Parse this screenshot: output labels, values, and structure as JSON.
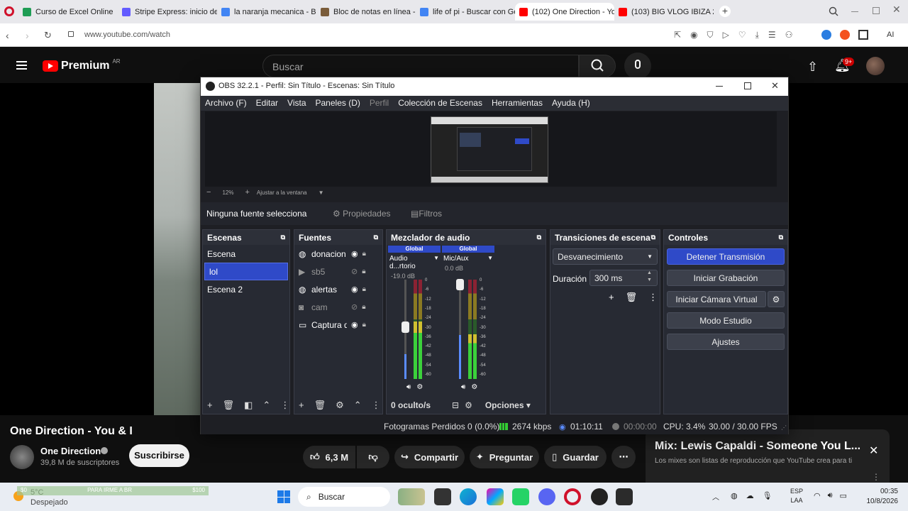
{
  "browser": {
    "tabs": [
      {
        "label": "Curso de Excel Online",
        "color": "#1f9d55"
      },
      {
        "label": "Stripe Express: inicio de se",
        "color": "#635bff"
      },
      {
        "label": "la naranja mecanica - Busc",
        "color": "#4285f4"
      },
      {
        "label": "Bloc de notas en línea - To",
        "color": "#7a5c3a"
      },
      {
        "label": "life of pi - Buscar con Goo",
        "color": "#4285f4"
      },
      {
        "label": "(102) One Direction - You",
        "color": "#ff0000"
      },
      {
        "label": "(103) BIG VLOG IBIZA 202",
        "color": "#ff0000"
      }
    ],
    "url": "www.youtube.com/watch",
    "new_tab": "+",
    "ai_label": "AI"
  },
  "youtube": {
    "logo_text": "Premium",
    "logo_region": "AR",
    "search_placeholder": "Buscar",
    "notif_count": "9+",
    "video_title": "One Direction - You & I",
    "channel_name": "One Direction",
    "subscribers": "39,8 M de suscriptores",
    "subscribe_label": "Suscribirse",
    "likes": "6,3 M",
    "share_label": "Compartir",
    "ask_label": "Preguntar",
    "save_label": "Guardar",
    "mix_title": "Mix: Lewis Capaldi - Someone You L...",
    "mix_subtitle": "Los mixes son listas de reproducción que YouTube crea para ti"
  },
  "obs": {
    "title": "OBS 32.2.1 - Perfil: Sin Título - Escenas: Sin Título",
    "menu": [
      "Archivo (F)",
      "Editar",
      "Vista",
      "Paneles (D)",
      "Perfil",
      "Colección de Escenas",
      "Herramientas",
      "Ayuda (H)"
    ],
    "zoom": "12%",
    "fit_label": "Ajustar a la ventana",
    "no_source": "Ninguna fuente selecciona",
    "properties": "Propiedades",
    "filters": "Filtros",
    "scenes": {
      "header": "Escenas",
      "items": [
        "Escena",
        "lol",
        "Escena 2"
      ],
      "selected": 1
    },
    "sources": {
      "header": "Fuentes",
      "items": [
        {
          "name": "donacion",
          "visible": true,
          "icon": "browser-icon"
        },
        {
          "name": "sb5",
          "visible": false,
          "icon": "media-icon"
        },
        {
          "name": "alertas",
          "visible": true,
          "icon": "browser-icon"
        },
        {
          "name": "cam",
          "visible": false,
          "icon": "camera-icon"
        },
        {
          "name": "Captura d",
          "visible": true,
          "icon": "display-icon"
        }
      ]
    },
    "mixer": {
      "header": "Mezclador de audio",
      "hidden": "0 oculto/s",
      "options": "Opciones",
      "channels": [
        {
          "scope": "Global",
          "name": "Audio d...rtorio",
          "db": "-19.0 dB",
          "level": 0.55
        },
        {
          "scope": "Global",
          "name": "Mic/Aux",
          "db": "0.0 dB",
          "level": 0.98
        }
      ],
      "scale": [
        "0",
        "-6",
        "-12",
        "-18",
        "-24",
        "-30",
        "-36",
        "-42",
        "-48",
        "-54",
        "-60"
      ]
    },
    "transitions": {
      "header": "Transiciones de escena",
      "selected": "Desvanecimiento",
      "duration_label": "Duración",
      "duration": "300 ms"
    },
    "controls": {
      "header": "Controles",
      "buttons": [
        "Detener Transmisión",
        "Iniciar Grabación",
        "Iniciar Cámara Virtual",
        "Modo Estudio",
        "Ajustes"
      ]
    },
    "status": {
      "dropped": "Fotogramas Perdidos 0 (0.0%)",
      "bitrate": "2674 kbps",
      "stream_time": "01:10:11",
      "rec_time": "00:00:00",
      "cpu": "CPU: 3.4%",
      "fps": "30.00 / 30.00 FPS"
    },
    "accent": "#2f4ac8"
  },
  "taskbar": {
    "weather_temp": "5°C",
    "weather_desc": "Despejado",
    "ticker": "PARA IRME A BR",
    "ticker_value": "$100",
    "search": "Buscar",
    "lang": "ESP",
    "lang2": "LAA",
    "time": "00:35",
    "date": "10/8/2026"
  }
}
